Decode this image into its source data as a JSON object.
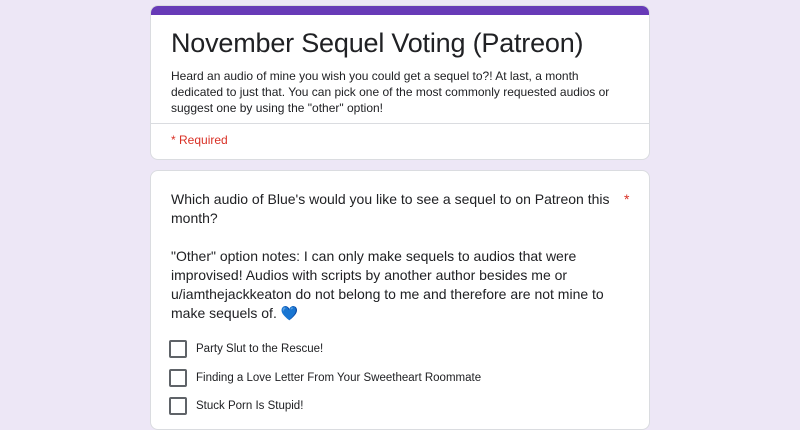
{
  "form": {
    "title": "November Sequel Voting (Patreon)",
    "description": "Heard an audio of mine you wish you could get a sequel to?! At last, a month dedicated to just that. You can pick one of the most commonly requested audios or suggest one by using the \"other\" option!",
    "required_note": "* Required"
  },
  "question": {
    "title": "Which audio of Blue's would you like to see a sequel to on Patreon this month?",
    "note": "\"Other\" option notes: I can only make sequels to audios that were improvised! Audios with scripts by another author besides me or u/iamthejackkeaton do not belong to me and therefore are not mine to make sequels of.",
    "note_emoji": "💙",
    "required_marker": "*",
    "options": [
      {
        "label": "Party Slut to the Rescue!",
        "checked": false
      },
      {
        "label": "Finding a Love Letter From Your Sweetheart Roommate",
        "checked": false
      },
      {
        "label": "Stuck Porn Is Stupid!",
        "checked": false
      }
    ]
  },
  "colors": {
    "accent": "#673ab7",
    "page_background": "#ede7f6",
    "required": "#d93025"
  },
  "icons": [
    "checkbox-icon",
    "blue-heart-icon"
  ]
}
